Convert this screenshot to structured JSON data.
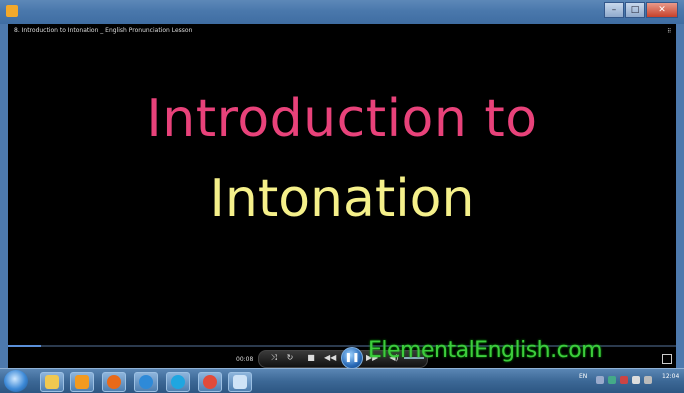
{
  "window": {
    "title": "8. Introduction to Intonation _ English Pronunciation Lesson"
  },
  "slide": {
    "line1": "Introduction to",
    "line2": "Intonation"
  },
  "player": {
    "elapsed": "00:08",
    "progress_fraction": 0.05,
    "watermark": "ElementalEnglish.com",
    "play_state_glyph": "❚❚",
    "icons": [
      "shuffle-icon",
      "repeat-icon",
      "stop-icon",
      "previous-icon",
      "pause-icon",
      "next-icon",
      "volume-icon",
      "fullscreen-icon"
    ]
  },
  "taskbar": {
    "language": "EN",
    "clock_time": "12:04",
    "pinned": [
      "start-orb",
      "explorer",
      "media-player",
      "firefox",
      "internet-explorer",
      "skype",
      "chrome",
      "notepad"
    ]
  },
  "colors": {
    "line1": "#e8427a",
    "line2": "#f5f08a",
    "watermark": "#3dcc3d"
  }
}
